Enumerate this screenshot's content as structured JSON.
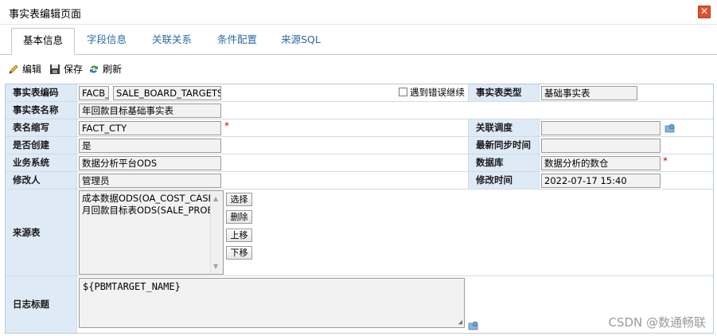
{
  "window": {
    "title": "事实表编辑页面",
    "close_glyph": "✕"
  },
  "tabs": [
    {
      "label": "基本信息"
    },
    {
      "label": "字段信息"
    },
    {
      "label": "关联关系"
    },
    {
      "label": "条件配置"
    },
    {
      "label": "来源SQL"
    }
  ],
  "toolbar": {
    "edit_label": "编辑",
    "save_label": "保存",
    "refresh_label": "刷新"
  },
  "form": {
    "code_label": "事实表编码",
    "code_prefix": "FACB_",
    "code_value": "SALE_BOARD_TARGETS",
    "error_continue_label": "遇到错误继续",
    "type_label": "事实表类型",
    "type_value": "基础事实表",
    "name_label": "事实表名称",
    "name_value": "年回款目标基础事实表",
    "abbr_label": "表名缩写",
    "abbr_value": "FACT_CTY",
    "required_mark": "*",
    "schedule_label": "关联调度",
    "schedule_value": "",
    "created_label": "是否创建",
    "created_value": "是",
    "sync_time_label": "最新同步时间",
    "sync_time_value": "",
    "system_label": "业务系统",
    "system_value": "数据分析平台ODS",
    "database_label": "数据库",
    "database_value": "数据分析的数仓",
    "modifier_label": "修改人",
    "modifier_value": "管理员",
    "modified_time_label": "修改时间",
    "modified_time_value": "2022-07-17 15:40",
    "source_label": "来源表",
    "source_items": [
      "成本数据ODS(OA_COST_CASE",
      "月回款目标表ODS(SALE_PROB/"
    ],
    "btn_select": "选择",
    "btn_delete": "删除",
    "btn_up": "上移",
    "btn_down": "下移",
    "log_label": "日志标题",
    "log_value": "${PBMTARGET_NAME}"
  },
  "watermark": "CSDN @数通畅联",
  "colors": {
    "label_bg": "#dfeaf7",
    "tab_active_text": "#000000",
    "tab_text": "#2f6aa5",
    "close_bg": "#e0512f"
  }
}
